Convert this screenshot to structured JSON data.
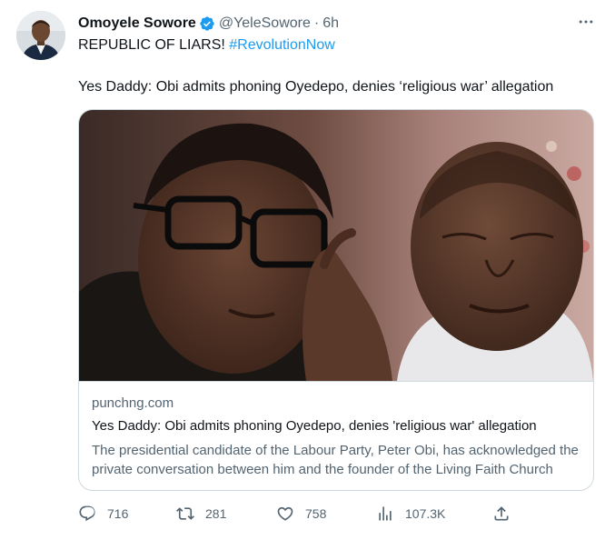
{
  "tweet": {
    "author_name": "Omoyele Sowore",
    "handle": "@YeleSowore",
    "separator": "·",
    "time": "6h",
    "text_line1": "REPUBLIC OF LIARS!",
    "hashtag": "#RevolutionNow",
    "text_line2": "Yes Daddy: Obi admits phoning Oyedepo, denies ‘religious war’ allegation"
  },
  "card": {
    "domain": "punchng.com",
    "title": "Yes Daddy: Obi admits phoning Oyedepo, denies 'religious war' allegation",
    "description": "The presidential candidate of the Labour Party, Peter Obi, has acknowledged the private conversation between him and the founder of the Living Faith Church"
  },
  "actions": {
    "replies": "716",
    "retweets": "281",
    "likes": "758",
    "views": "107.3K"
  },
  "colors": {
    "accent": "#1d9bf0",
    "secondary_text": "#536471",
    "border": "#cfd9de"
  },
  "icons": [
    "verified-badge-icon",
    "more-icon",
    "reply-icon",
    "retweet-icon",
    "like-icon",
    "views-icon",
    "share-icon"
  ]
}
